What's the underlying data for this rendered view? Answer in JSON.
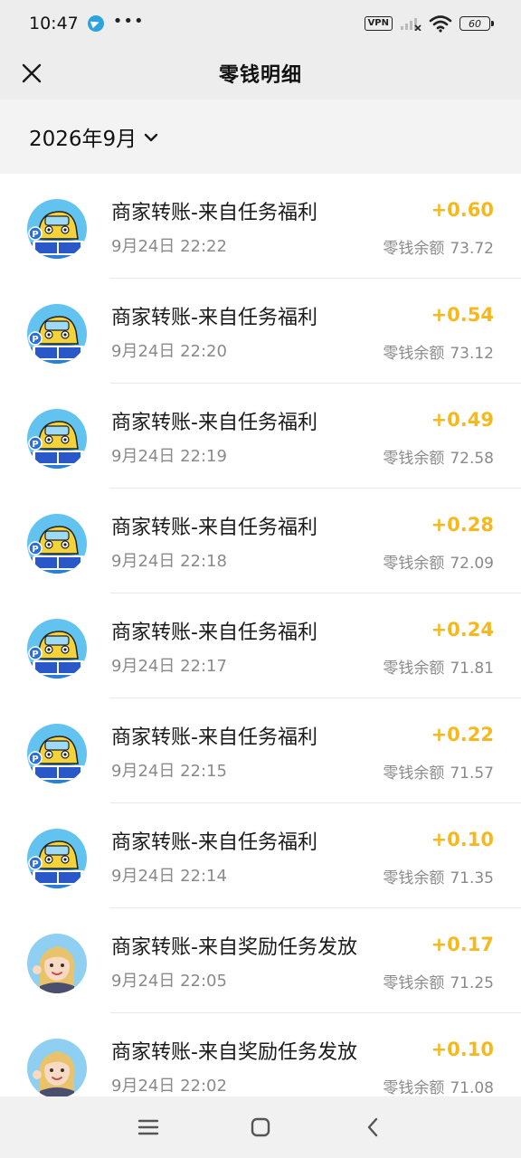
{
  "status_bar": {
    "time": "10:47",
    "dots": "•••",
    "vpn": "VPN",
    "battery": "60"
  },
  "header": {
    "title": "零钱明细",
    "close_icon": "close-icon"
  },
  "filter": {
    "month": "2026年9月"
  },
  "balance_label": "零钱余额",
  "transactions": [
    {
      "title": "商家转账-来自任务福利",
      "time": "9月24日 22:22",
      "amount": "+0.60",
      "balance": "73.72",
      "avatar": "car-avatar"
    },
    {
      "title": "商家转账-来自任务福利",
      "time": "9月24日 22:20",
      "amount": "+0.54",
      "balance": "73.12",
      "avatar": "car-avatar"
    },
    {
      "title": "商家转账-来自任务福利",
      "time": "9月24日 22:19",
      "amount": "+0.49",
      "balance": "72.58",
      "avatar": "car-avatar"
    },
    {
      "title": "商家转账-来自任务福利",
      "time": "9月24日 22:18",
      "amount": "+0.28",
      "balance": "72.09",
      "avatar": "car-avatar"
    },
    {
      "title": "商家转账-来自任务福利",
      "time": "9月24日 22:17",
      "amount": "+0.24",
      "balance": "71.81",
      "avatar": "car-avatar"
    },
    {
      "title": "商家转账-来自任务福利",
      "time": "9月24日 22:15",
      "amount": "+0.22",
      "balance": "71.57",
      "avatar": "car-avatar"
    },
    {
      "title": "商家转账-来自任务福利",
      "time": "9月24日 22:14",
      "amount": "+0.10",
      "balance": "71.35",
      "avatar": "car-avatar"
    },
    {
      "title": "商家转账-来自奖励任务发放",
      "time": "9月24日 22:05",
      "amount": "+0.17",
      "balance": "71.25",
      "avatar": "woman-avatar"
    },
    {
      "title": "商家转账-来自奖励任务发放",
      "time": "9月24日 22:02",
      "amount": "+0.10",
      "balance": "71.08",
      "avatar": "woman-avatar"
    }
  ],
  "colors": {
    "amount": "#f5b81d",
    "header_bg": "#ededed",
    "secondary_text": "#8a8a8a"
  }
}
